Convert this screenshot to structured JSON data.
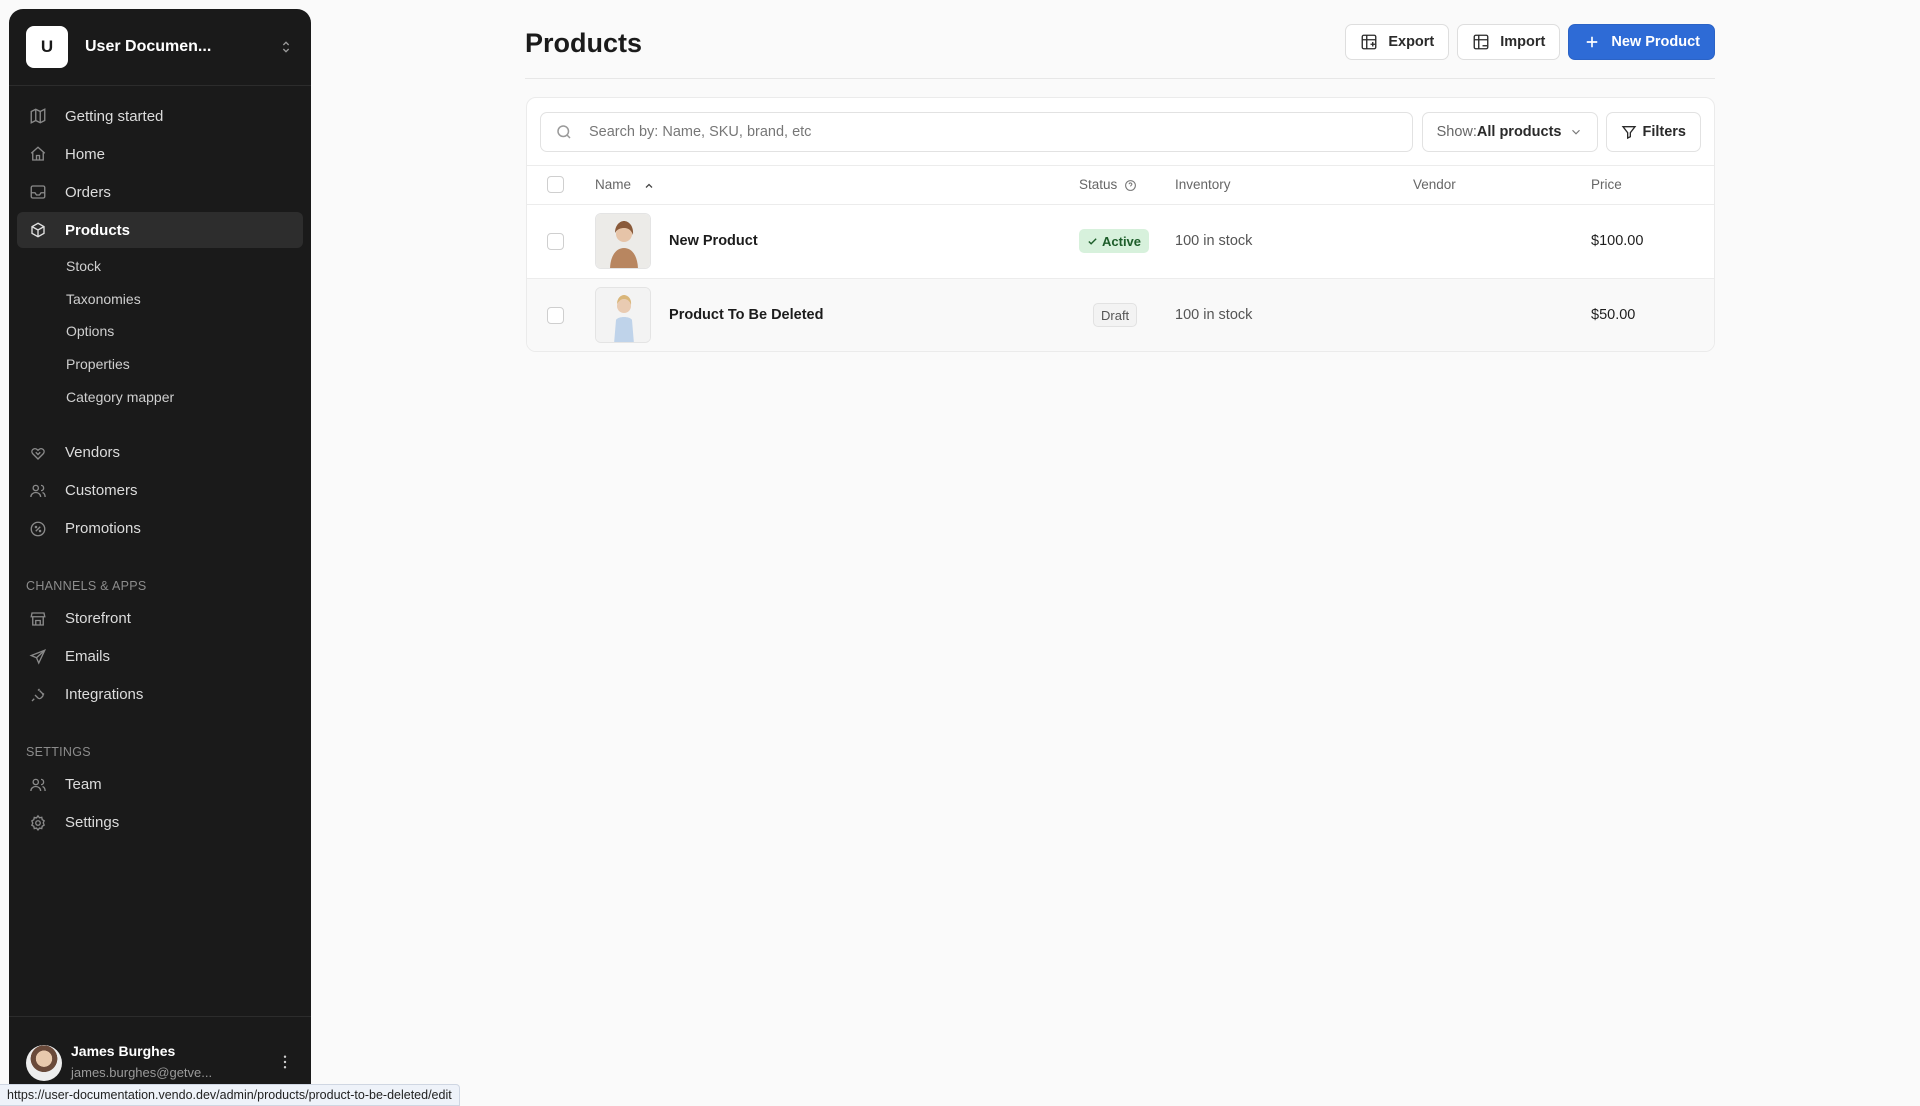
{
  "sidebar": {
    "workspace": {
      "initial": "U",
      "name": "User Documen..."
    },
    "nav_main": [
      {
        "label": "Getting started",
        "icon": "map-icon"
      },
      {
        "label": "Home",
        "icon": "home-icon"
      },
      {
        "label": "Orders",
        "icon": "inbox-icon"
      },
      {
        "label": "Products",
        "icon": "box-icon",
        "active": true
      }
    ],
    "products_sub": [
      "Stock",
      "Taxonomies",
      "Options",
      "Properties",
      "Category mapper"
    ],
    "nav_more": [
      {
        "label": "Vendors",
        "icon": "handshake-icon"
      },
      {
        "label": "Customers",
        "icon": "users-icon"
      },
      {
        "label": "Promotions",
        "icon": "discount-icon"
      }
    ],
    "channels_label": "CHANNELS & APPS",
    "channels": [
      {
        "label": "Storefront",
        "icon": "store-icon"
      },
      {
        "label": "Emails",
        "icon": "send-icon"
      },
      {
        "label": "Integrations",
        "icon": "plug-icon"
      }
    ],
    "settings_label": "SETTINGS",
    "settings": [
      {
        "label": "Team",
        "icon": "team-icon"
      },
      {
        "label": "Settings",
        "icon": "gear-icon"
      }
    ],
    "user": {
      "name": "James Burghes",
      "email": "james.burghes@getve..."
    }
  },
  "header": {
    "title": "Products",
    "export_label": "Export",
    "import_label": "Import",
    "new_label": "New Product"
  },
  "toolbar": {
    "search_placeholder": "Search by: Name, SKU, brand, etc",
    "show_prefix": "Show:",
    "show_value": "All products",
    "filters_label": "Filters"
  },
  "table": {
    "columns": {
      "name": "Name",
      "status": "Status",
      "inventory": "Inventory",
      "vendor": "Vendor",
      "price": "Price"
    },
    "rows": [
      {
        "name": "New Product",
        "status": "Active",
        "inventory": "100 in stock",
        "vendor": "",
        "price": "$100.00"
      },
      {
        "name": "Product To Be Deleted",
        "status": "Draft",
        "inventory": "100 in stock",
        "vendor": "",
        "price": "$50.00"
      }
    ]
  },
  "statusbar": {
    "url": "https://user-documentation.vendo.dev/admin/products/product-to-be-deleted/edit"
  },
  "colors": {
    "primary": "#2e6bd6",
    "sidebar_bg": "#1a1a1a",
    "active_badge": "#d7f1dc"
  }
}
